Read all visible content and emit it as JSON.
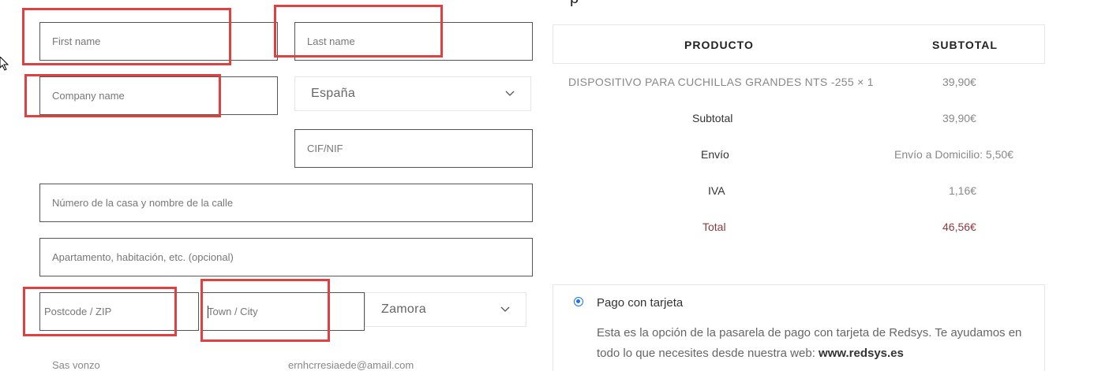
{
  "form": {
    "first_name_placeholder": "First name",
    "last_name_placeholder": "Last name",
    "company_placeholder": "Company name",
    "country_value": "España",
    "cif_placeholder": "CIF/NIF",
    "street_placeholder": "Número de la casa y nombre de la calle",
    "apartment_placeholder": "Apartamento, habitación, etc. (opcional)",
    "postcode_placeholder": "Postcode / ZIP",
    "city_placeholder": "Town / City",
    "province_value": "Zamora",
    "cut_left": "Sas vonzo",
    "cut_right": "ernhcrresiaede@amail.com"
  },
  "order": {
    "heading_cut": "p",
    "col_product": "PRODUCTO",
    "col_subtotal": "SUBTOTAL",
    "item_name": "DISPOSITIVO PARA CUCHILLAS GRANDES NTS -255  × 1",
    "item_price": "39,90€",
    "subtotal_label": "Subtotal",
    "subtotal_value": "39,90€",
    "shipping_label": "Envío",
    "shipping_value": "Envío a Domicilio: 5,50€",
    "tax_label": "IVA",
    "tax_value": "1,16€",
    "total_label": "Total",
    "total_value": "46,56€"
  },
  "payment": {
    "method_label": "Pago con tarjeta",
    "description": "Esta es la opción de la pasarela de pago con tarjeta de Redsys. Te ayudamos en todo lo que necesites desde nuestra web: ",
    "website": "www.redsys.es"
  },
  "colors": {
    "highlight": "#e04040",
    "accent": "#1a73e8",
    "total": "#8a3a40"
  }
}
